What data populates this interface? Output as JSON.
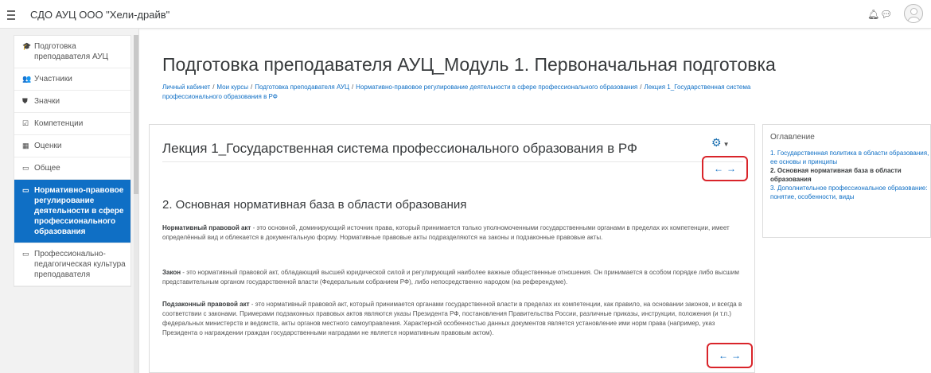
{
  "navbar": {
    "site_name": "СДО АУЦ ООО \"Хели-драйв\"",
    "notification_icon": "bell-icon",
    "messages_icon": "chat-bubble-icon",
    "user_icon": "user-avatar"
  },
  "sidebar": {
    "items": [
      {
        "icon": "graduation-cap-icon",
        "glyph": "🎓",
        "label": "Подготовка преподавателя АУЦ",
        "active": false
      },
      {
        "icon": "users-icon",
        "glyph": "👥",
        "label": "Участники",
        "active": false
      },
      {
        "icon": "shield-icon",
        "glyph": "⛊",
        "label": "Значки",
        "active": false
      },
      {
        "icon": "checkbox-icon",
        "glyph": "☑",
        "label": "Компетенции",
        "active": false
      },
      {
        "icon": "table-icon",
        "glyph": "▦",
        "label": "Оценки",
        "active": false
      },
      {
        "icon": "folder-icon",
        "glyph": "▭",
        "label": "Общее",
        "active": false
      },
      {
        "icon": "folder-icon",
        "glyph": "▭",
        "label": "Нормативно-правовое регулирование деятельности в сфере профессионального образования",
        "active": true
      },
      {
        "icon": "folder-icon",
        "glyph": "▭",
        "label": "Профессионально-педагогическая культура преподавателя",
        "active": false
      }
    ]
  },
  "header": {
    "title": "Подготовка преподавателя АУЦ_Модуль 1. Первоначальная подготовка",
    "breadcrumb": [
      "Личный кабинет",
      "Мои курсы",
      "Подготовка преподавателя АУЦ",
      "Нормативно-правовое регулирование деятельности в сфере профессионального образования",
      "Лекция 1_Государственная система профессионального образования в РФ"
    ]
  },
  "main": {
    "lecture_title": "Лекция 1_Государственная система профессионального образования в РФ",
    "prev_arrow": "←",
    "next_arrow": "→",
    "section_heading": "2. Основная нормативная база в области образования",
    "paragraphs": [
      {
        "term": "Нормативный правовой акт",
        "text": " - это основной, доминирующий источник права, который принимается только уполномоченными государственными органами в пределах их компетенции, имеет определённый вид и облекается в документальную форму. Нормативные правовые акты подразделяются на законы и подзаконные правовые акты."
      },
      {
        "term": "Закон",
        "text": " - это нормативный правовой акт, обладающий высшей юридической силой и регулирующий наиболее важные общественные отношения. Он принимается в особом порядке либо высшим представительным органом государственной власти (Федеральным собранием РФ), либо непосредственно народом (на референдуме)."
      },
      {
        "term": "Подзаконный правовой акт",
        "text": " - это нормативный правовой акт, который принимается органами государственной власти в пределах их компетенции, как правило, на основании законов, и всегда в соответствии с законами. Примерами подзаконных правовых актов являются указы Президента РФ, постановления Правительства России, различные приказы, инструкции, положения (и т.п.) федеральных министерств и ведомств, акты органов местного самоуправления. Характерной особенностью данных документов является установление ими норм права (например, указ Президента о награждении граждан государственными наградами не является нормативным правовым актом)."
      }
    ]
  },
  "toc": {
    "title": "Оглавление",
    "items": [
      {
        "label": "1. Государственная политика в области образования, ее основы и принципы",
        "current": false
      },
      {
        "label": "2. Основная нормативная база в области образования",
        "current": true
      },
      {
        "label": "3. Дополнительное профессиональное образование: понятие, особенности, виды",
        "current": false
      }
    ]
  },
  "colors": {
    "brand": "#0f6fc5",
    "highlight_box": "#d9242a"
  }
}
